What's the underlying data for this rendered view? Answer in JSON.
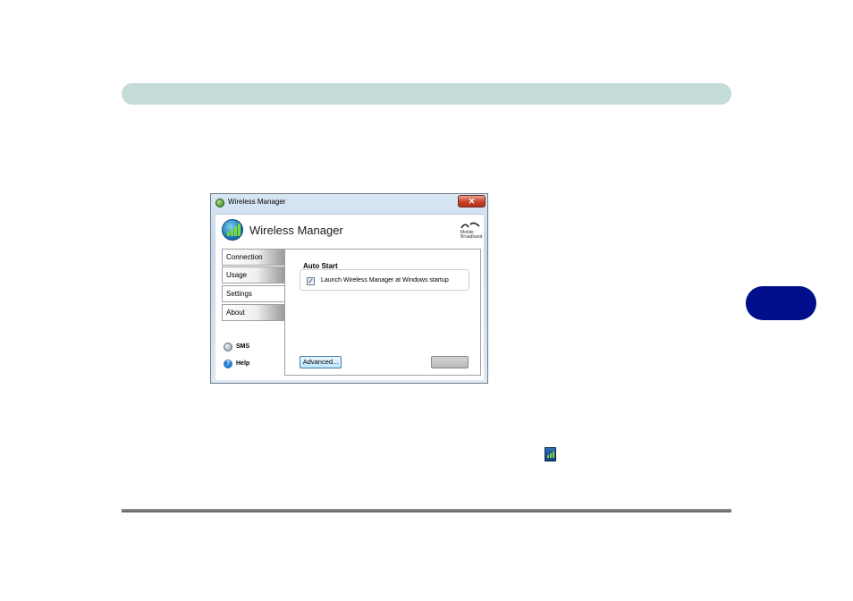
{
  "window": {
    "title": "Wireless Manager",
    "close_glyph": "✕",
    "app_title": "Wireless Manager",
    "brand_logo_text": [
      "Mobile",
      "Broadband"
    ]
  },
  "nav": {
    "items": [
      {
        "label": "Connection",
        "active": false
      },
      {
        "label": "Usage",
        "active": false
      },
      {
        "label": "Settings",
        "active": true
      },
      {
        "label": "About",
        "active": false
      }
    ],
    "sms_label": "SMS",
    "help_label": "Help"
  },
  "settings": {
    "group_title": "Auto Start",
    "checkbox_label": "Launch Wireless Manager at Windows startup",
    "checkbox_checked": true,
    "checkbox_glyph": "✓",
    "advanced_button": "Advanced...",
    "disabled_button": ""
  },
  "icons": {
    "title_icon": "globe-icon",
    "app_logo": "signal-globe-icon",
    "tray_icon": "wireless-manager-tray-icon"
  },
  "colors": {
    "header_bar": "#c4dcd8",
    "chapter_tab": "#000e8c"
  }
}
